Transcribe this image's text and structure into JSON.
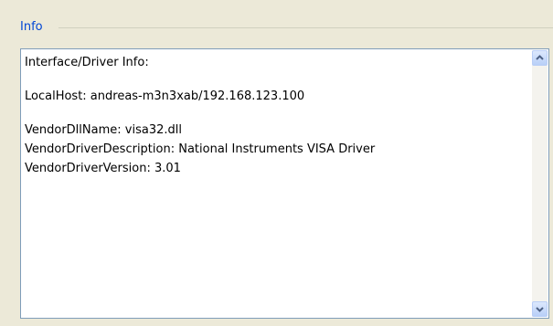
{
  "group": {
    "title": "Info"
  },
  "info_text": {
    "lines": [
      "Interface/Driver Info:",
      "",
      "LocalHost: andreas-m3n3xab/192.168.123.100",
      "",
      "VendorDllName: visa32.dll",
      "VendorDriverDescription: National Instruments VISA Driver",
      "VendorDriverVersion: 3.01"
    ]
  },
  "icons": {
    "scroll_up": "chevron-up-icon",
    "scroll_down": "chevron-down-icon"
  },
  "colors": {
    "title": "#0046D5",
    "background": "#ECE9D8",
    "border": "#7F9DB9"
  }
}
